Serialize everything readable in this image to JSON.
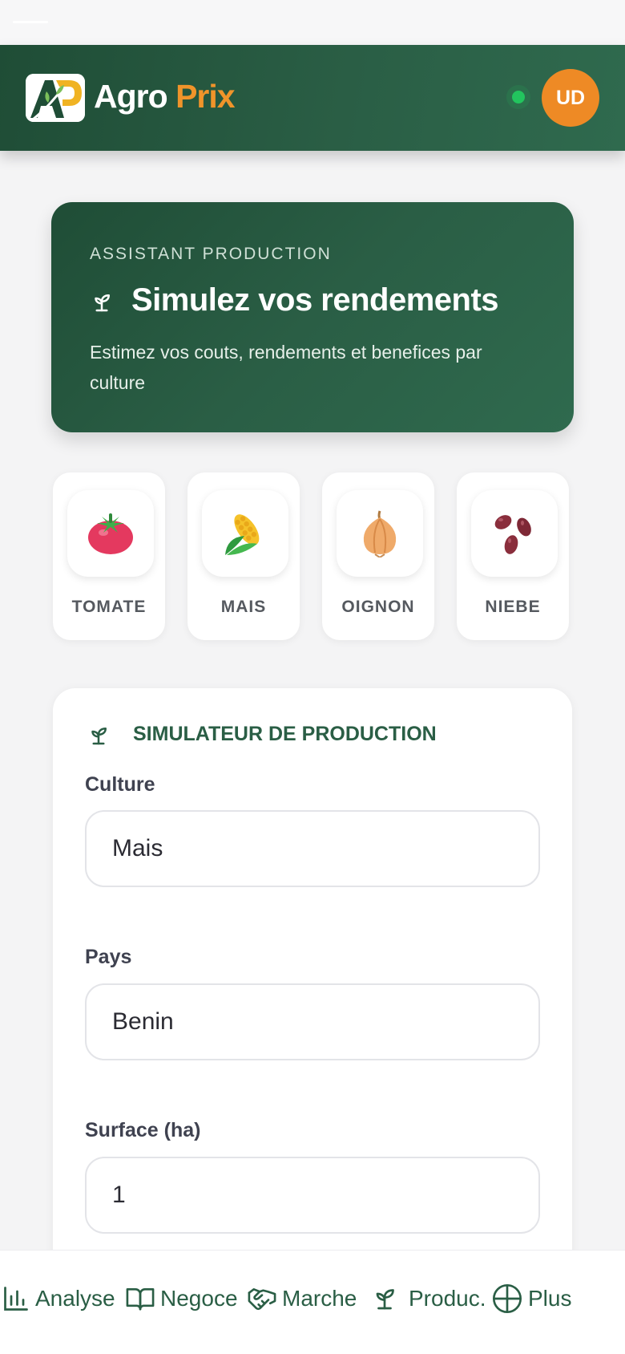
{
  "header": {
    "brand_first": "Agro",
    "brand_second": "Prix",
    "avatar_initials": "UD"
  },
  "hero": {
    "eyebrow": "ASSISTANT PRODUCTION",
    "title": "Simulez vos rendements",
    "description": "Estimez vos couts, rendements et benefices par culture"
  },
  "crops": [
    {
      "label": "TOMATE",
      "icon": "tomato-icon"
    },
    {
      "label": "MAIS",
      "icon": "corn-icon"
    },
    {
      "label": "OIGNON",
      "icon": "onion-icon"
    },
    {
      "label": "NIEBE",
      "icon": "beans-icon"
    }
  ],
  "simulator": {
    "title": "SIMULATEUR DE PRODUCTION",
    "culture_label": "Culture",
    "culture_value": "Mais",
    "pays_label": "Pays",
    "pays_value": "Benin",
    "surface_label": "Surface (ha)",
    "surface_value": "1"
  },
  "nav": {
    "items": [
      {
        "label": "Analyse",
        "icon": "bar-chart-icon"
      },
      {
        "label": "Negoce",
        "icon": "book-icon"
      },
      {
        "label": "Marche",
        "icon": "handshake-icon"
      },
      {
        "label": "Produc.",
        "icon": "sprout-icon"
      },
      {
        "label": "Plus",
        "icon": "globe-icon"
      }
    ]
  },
  "colors": {
    "primary_green": "#2a5e45",
    "accent_orange": "#ee8a25",
    "online_green": "#22c55e"
  }
}
